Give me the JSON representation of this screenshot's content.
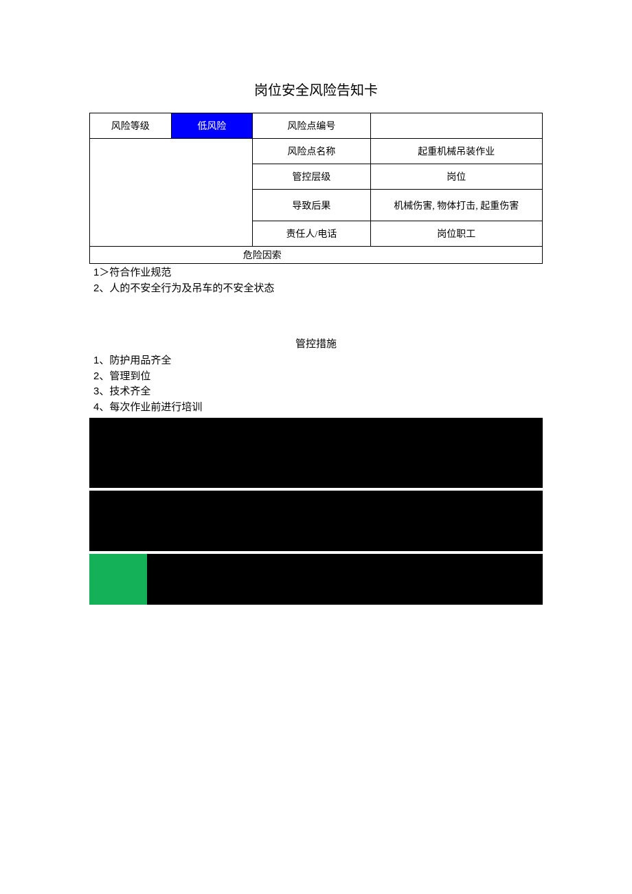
{
  "title": "岗位安全风险告知卡",
  "table": {
    "risk_level_label": "风险等级",
    "risk_level_value": "低风险",
    "risk_point_no_label": "风险点编号",
    "risk_point_no_value": "",
    "risk_point_name_label": "风险点名称",
    "risk_point_name_value": "起重机械吊装作业",
    "control_level_label": "管控层级",
    "control_level_value": "岗位",
    "consequence_label": "导致后果",
    "consequence_value": "机械伤害, 物体打击, 起重伤害",
    "responsible_label": "责任人/电话",
    "responsible_value": "岗位职工",
    "danger_left": "危",
    "danger_right": "险因索"
  },
  "risk_factors": {
    "item1": "1＞符合作业规范",
    "item2": "2、人的不安全行为及吊车的不安全状态"
  },
  "control_measures": {
    "heading": "管控措施",
    "item1": "1、防护用品齐全",
    "item2": "2、管理到位",
    "item3": "3、技术齐全",
    "item4": "4、每次作业前进行培训"
  },
  "colors": {
    "risk_level_bg": "#0000ff",
    "green_block": "#14b158",
    "black_block": "#000000"
  }
}
